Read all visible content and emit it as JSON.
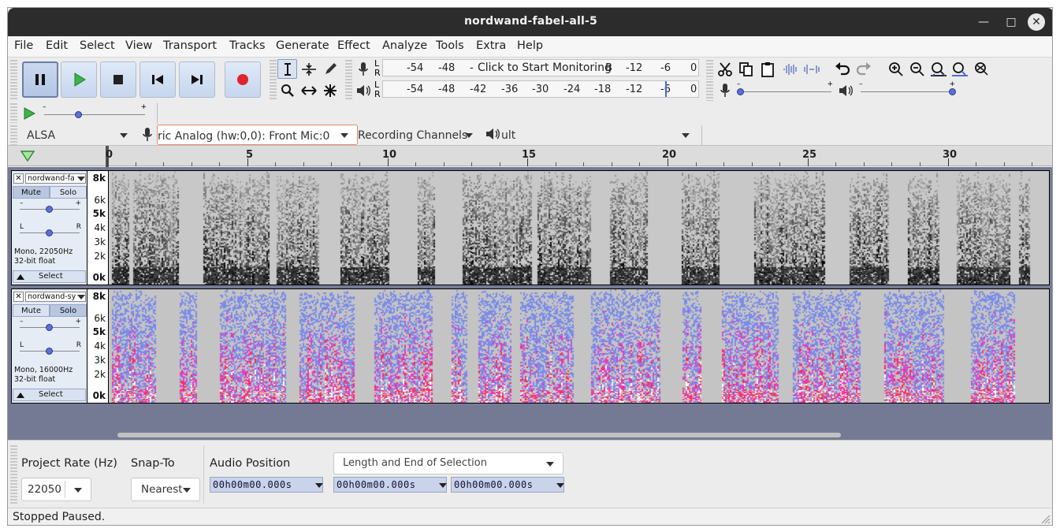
{
  "window": {
    "title": "nordwand-fabel-all-5"
  },
  "menu": [
    "File",
    "Edit",
    "Select",
    "View",
    "Transport",
    "Tracks",
    "Generate",
    "Effect",
    "Analyze",
    "Tools",
    "Extra",
    "Help"
  ],
  "meters": {
    "rec_ticks": [
      "-54",
      "-48",
      "-",
      "B",
      "-12",
      "-6",
      "0"
    ],
    "rec_prompt": "Click to Start Monitoring",
    "play_ticks": [
      "-54",
      "-48",
      "-42",
      "-36",
      "-30",
      "-24",
      "-18",
      "-12",
      "-6",
      "0"
    ],
    "L": "L",
    "R": "R"
  },
  "sliders": {
    "minus": "–",
    "plus": "+"
  },
  "device": {
    "host": "ALSA",
    "recording_device": "ric Analog (hw:0,0): Front Mic:0",
    "channels": "Recording Channels",
    "playback_device": "ult"
  },
  "ruler": {
    "labels": [
      "0",
      "5",
      "10",
      "15",
      "20",
      "25",
      "30"
    ]
  },
  "tracks": [
    {
      "name": "nordwand-fa",
      "mute": "Mute",
      "solo": "Solo",
      "info1": "Mono, 22050Hz",
      "info2": "32-bit float",
      "select": "Select",
      "scale": [
        "8k",
        "6k",
        "5k",
        "4k",
        "3k",
        "2k",
        "0k"
      ],
      "colormap": "grayscale"
    },
    {
      "name": "nordwand-sy",
      "mute": "Mute",
      "solo": "Solo",
      "info1": "Mono, 16000Hz",
      "info2": "32-bit float",
      "select": "Select",
      "scale": [
        "8k",
        "6k",
        "5k",
        "4k",
        "3k",
        "2k",
        "0k"
      ],
      "colormap": "color"
    }
  ],
  "bottom": {
    "project_rate_label": "Project Rate (Hz)",
    "project_rate_value": "22050",
    "snap_label": "Snap-To",
    "snap_value": "Nearest",
    "audio_position_label": "Audio Position",
    "selection_mode": "Length and End of Selection",
    "time1": "00h00m00.000s",
    "time2": "00h00m00.000s",
    "time3": "00h00m00.000s"
  },
  "status": "Stopped Paused.",
  "colors": {
    "title_bg": "#2c2c2c",
    "track_bg": "#757a94",
    "time_field": "#c9d3ea",
    "record": "#e0242d",
    "play": "#3db34a"
  }
}
